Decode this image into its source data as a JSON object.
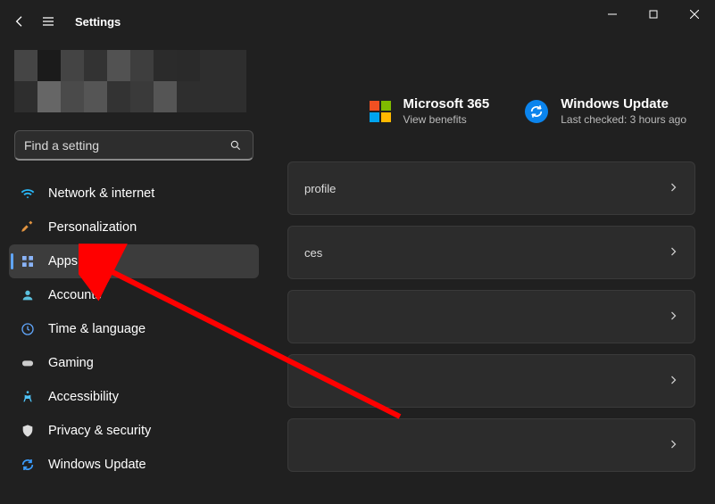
{
  "window": {
    "title": "Settings"
  },
  "search": {
    "placeholder": "Find a setting"
  },
  "nav": [
    {
      "key": "network",
      "label": "Network & internet",
      "icon": "wifi",
      "selected": false
    },
    {
      "key": "personalization",
      "label": "Personalization",
      "icon": "brush",
      "selected": false
    },
    {
      "key": "apps",
      "label": "Apps",
      "icon": "apps",
      "selected": true
    },
    {
      "key": "accounts",
      "label": "Accounts",
      "icon": "person",
      "selected": false
    },
    {
      "key": "time",
      "label": "Time & language",
      "icon": "clock",
      "selected": false
    },
    {
      "key": "gaming",
      "label": "Gaming",
      "icon": "gamepad",
      "selected": false
    },
    {
      "key": "accessibility",
      "label": "Accessibility",
      "icon": "accessibility",
      "selected": false
    },
    {
      "key": "privacy",
      "label": "Privacy & security",
      "icon": "shield",
      "selected": false
    },
    {
      "key": "wu",
      "label": "Windows Update",
      "icon": "update",
      "selected": false
    }
  ],
  "tiles": {
    "ms365": {
      "title": "Microsoft 365",
      "sub": "View benefits"
    },
    "wu": {
      "title": "Windows Update",
      "sub": "Last checked: 3 hours ago"
    }
  },
  "cards": [
    {
      "label": "profile"
    },
    {
      "label": "ces"
    },
    {
      "label": ""
    },
    {
      "label": ""
    },
    {
      "label": ""
    }
  ]
}
